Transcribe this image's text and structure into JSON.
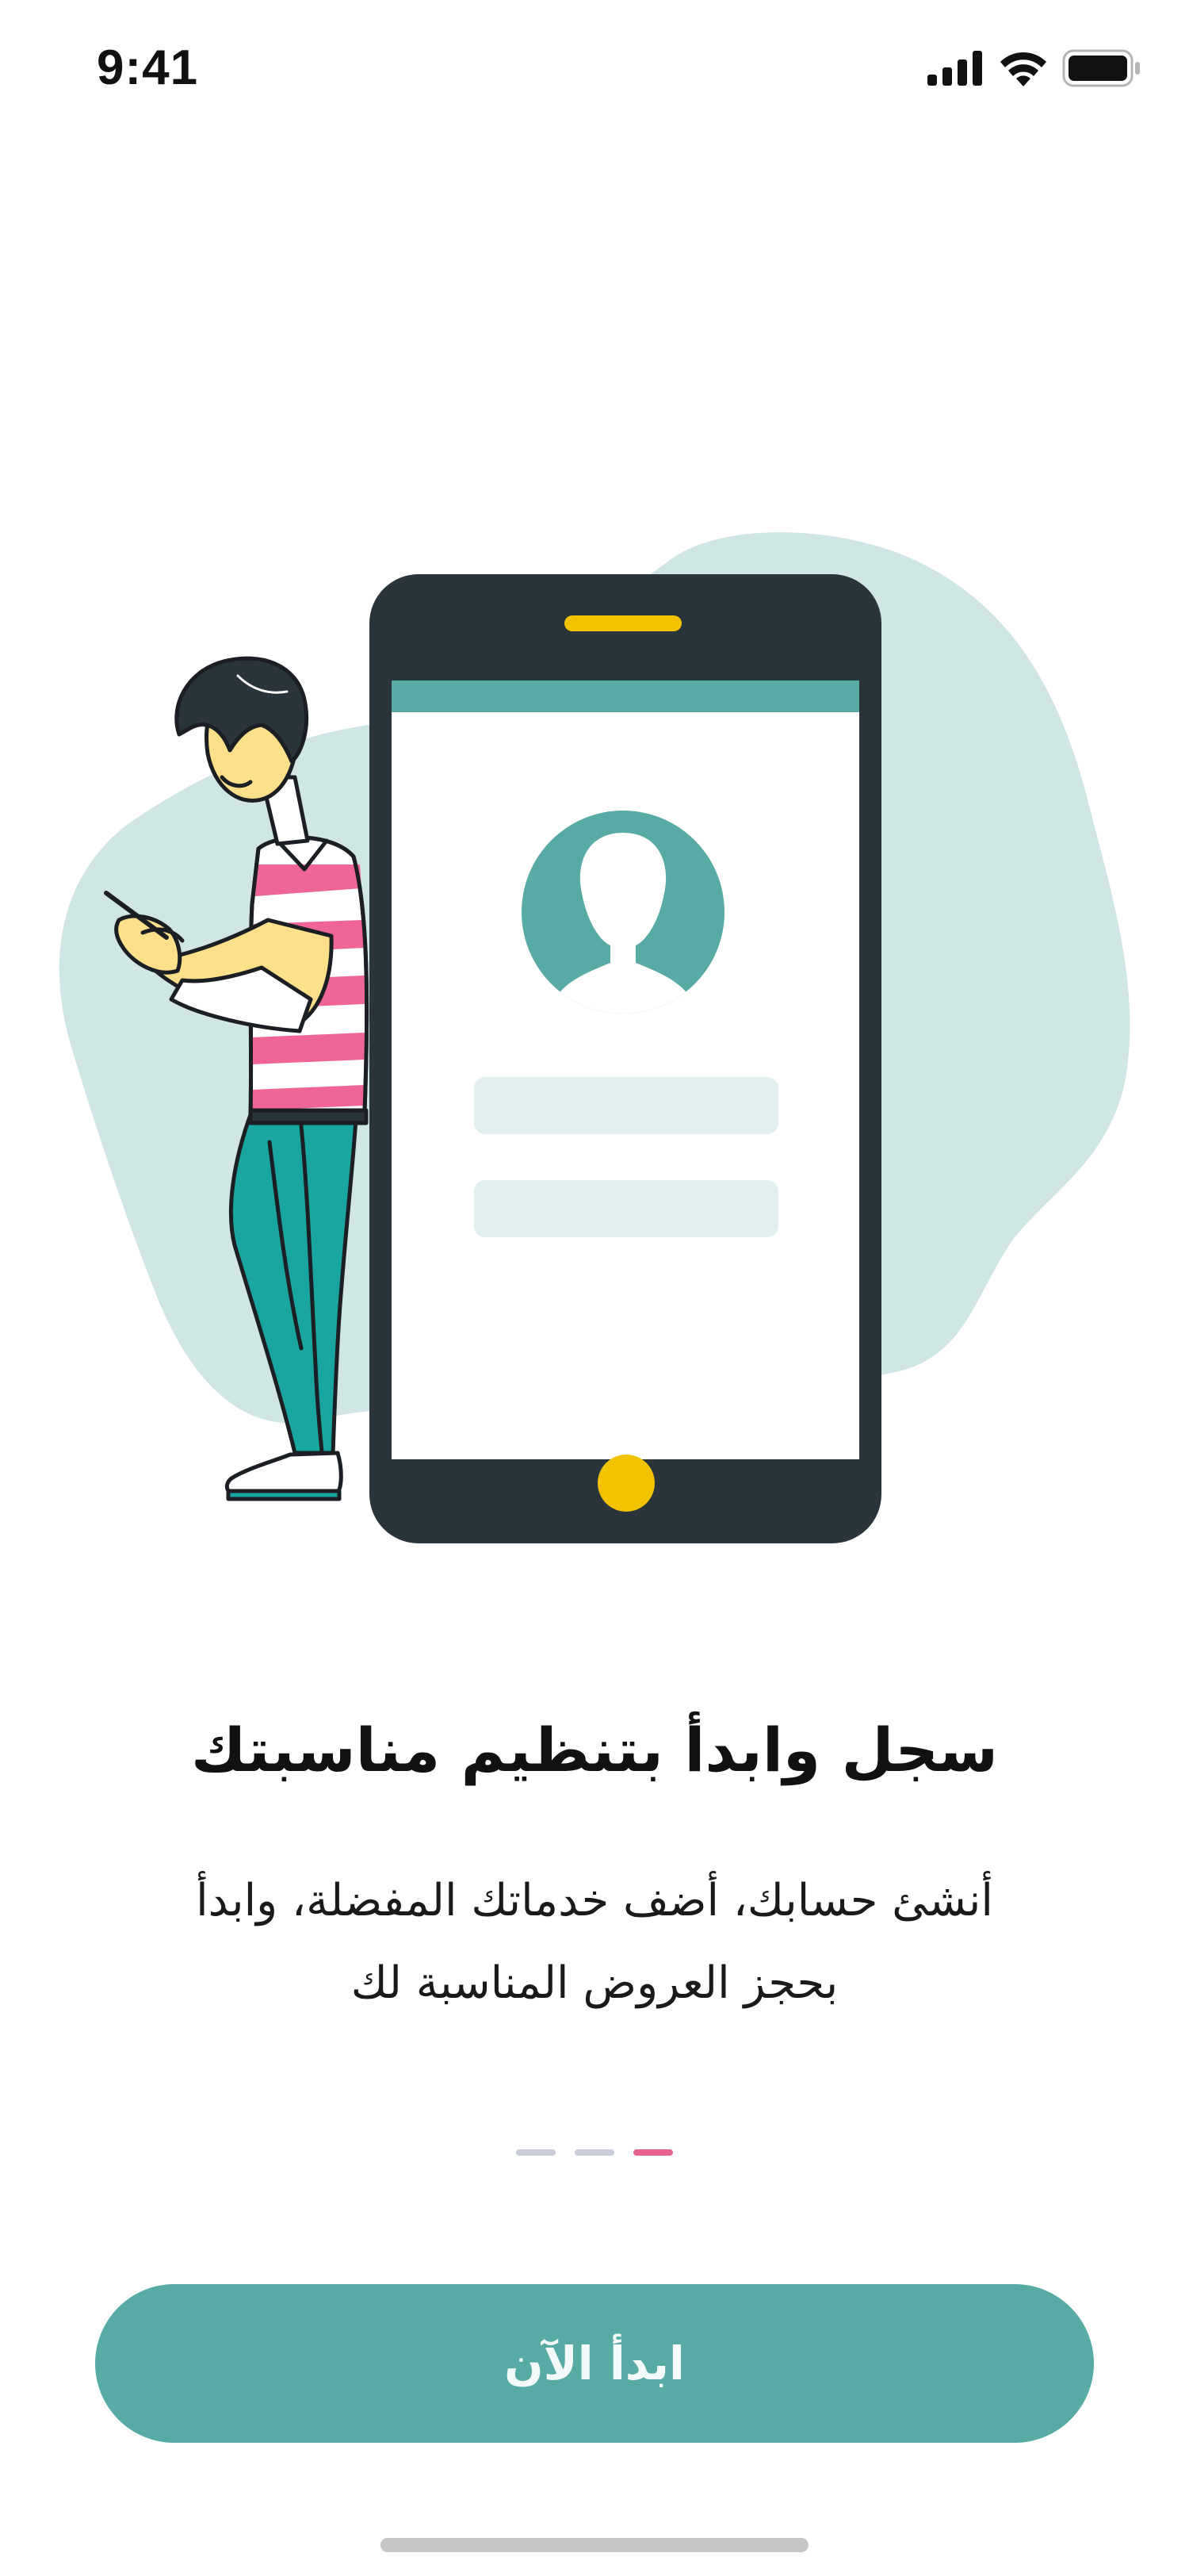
{
  "status_bar": {
    "time": "9:41",
    "icons": [
      "cellular-signal-icon",
      "wifi-icon",
      "battery-icon"
    ]
  },
  "illustration": {
    "name": "person-with-phone-illustration",
    "colors": {
      "blob": "#cfe6e4",
      "phone_body": "#29343b",
      "phone_accent": "#f4c300",
      "screen_header": "#58aaa4",
      "avatar": "#58aaa4",
      "input_placeholder": "#e1f0ef",
      "shirt_stripe": "#f06597",
      "pants": "#1aa6a0"
    }
  },
  "onboarding": {
    "title": "سجل وابدأ بتنظيم مناسبتك",
    "description_line1": "أنشئ حسابك، أضف خدماتك المفضلة، وابدأ",
    "description_line2": "بحجز العروض المناسبة لك"
  },
  "pager": {
    "total": 3,
    "active_index": 0
  },
  "cta": {
    "label": "ابدأ الآن"
  },
  "theme": {
    "primary": "#58aaa4",
    "pager_active": "#e8628f",
    "pager_inactive": "#c9ccd9"
  }
}
